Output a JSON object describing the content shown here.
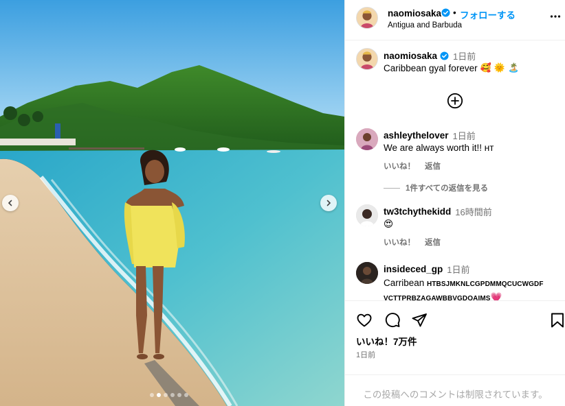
{
  "post": {
    "image_alt": "Woman in yellow gingham cover-up standing on a Caribbean beach with green hills",
    "carousel": {
      "total": 6,
      "active_index": 1
    }
  },
  "header": {
    "username": "naomiosaka",
    "separator": "•",
    "follow_label": "フォローする",
    "location": "Antigua and Barbuda"
  },
  "caption": {
    "username": "naomiosaka",
    "time": "1日前",
    "text": "Caribbean gyal forever",
    "emojis": [
      "🥰",
      "🌞",
      "🏝️"
    ]
  },
  "comments": [
    {
      "username": "ashleythelover",
      "time": "1日前",
      "text": "We are always worth it!! ʜᴛ",
      "like_label": "いいね！",
      "reply_label": "返信",
      "view_replies": "1件すべての返信を見る"
    },
    {
      "username": "tw3tchythekidd",
      "time": "16時間前",
      "text": "😍",
      "like_label": "いいね！",
      "reply_label": "返信"
    },
    {
      "username": "insideced_gp",
      "time": "1日前",
      "text_prefix": "Carribean ",
      "text_caps": "HTBSJMKNLCGPDMMQCUCWGDF VCTTPRBZAGAWBBVGDOAIMS",
      "text_emoji": "💗"
    }
  ],
  "actions": {
    "likes": "いいね！7万件",
    "time": "1日前"
  },
  "footer": {
    "restricted": "この投稿へのコメントは制限されています。"
  },
  "colors": {
    "accent": "#0095f6",
    "muted": "#737373",
    "border": "#efefef",
    "verified": "#0095f6"
  }
}
